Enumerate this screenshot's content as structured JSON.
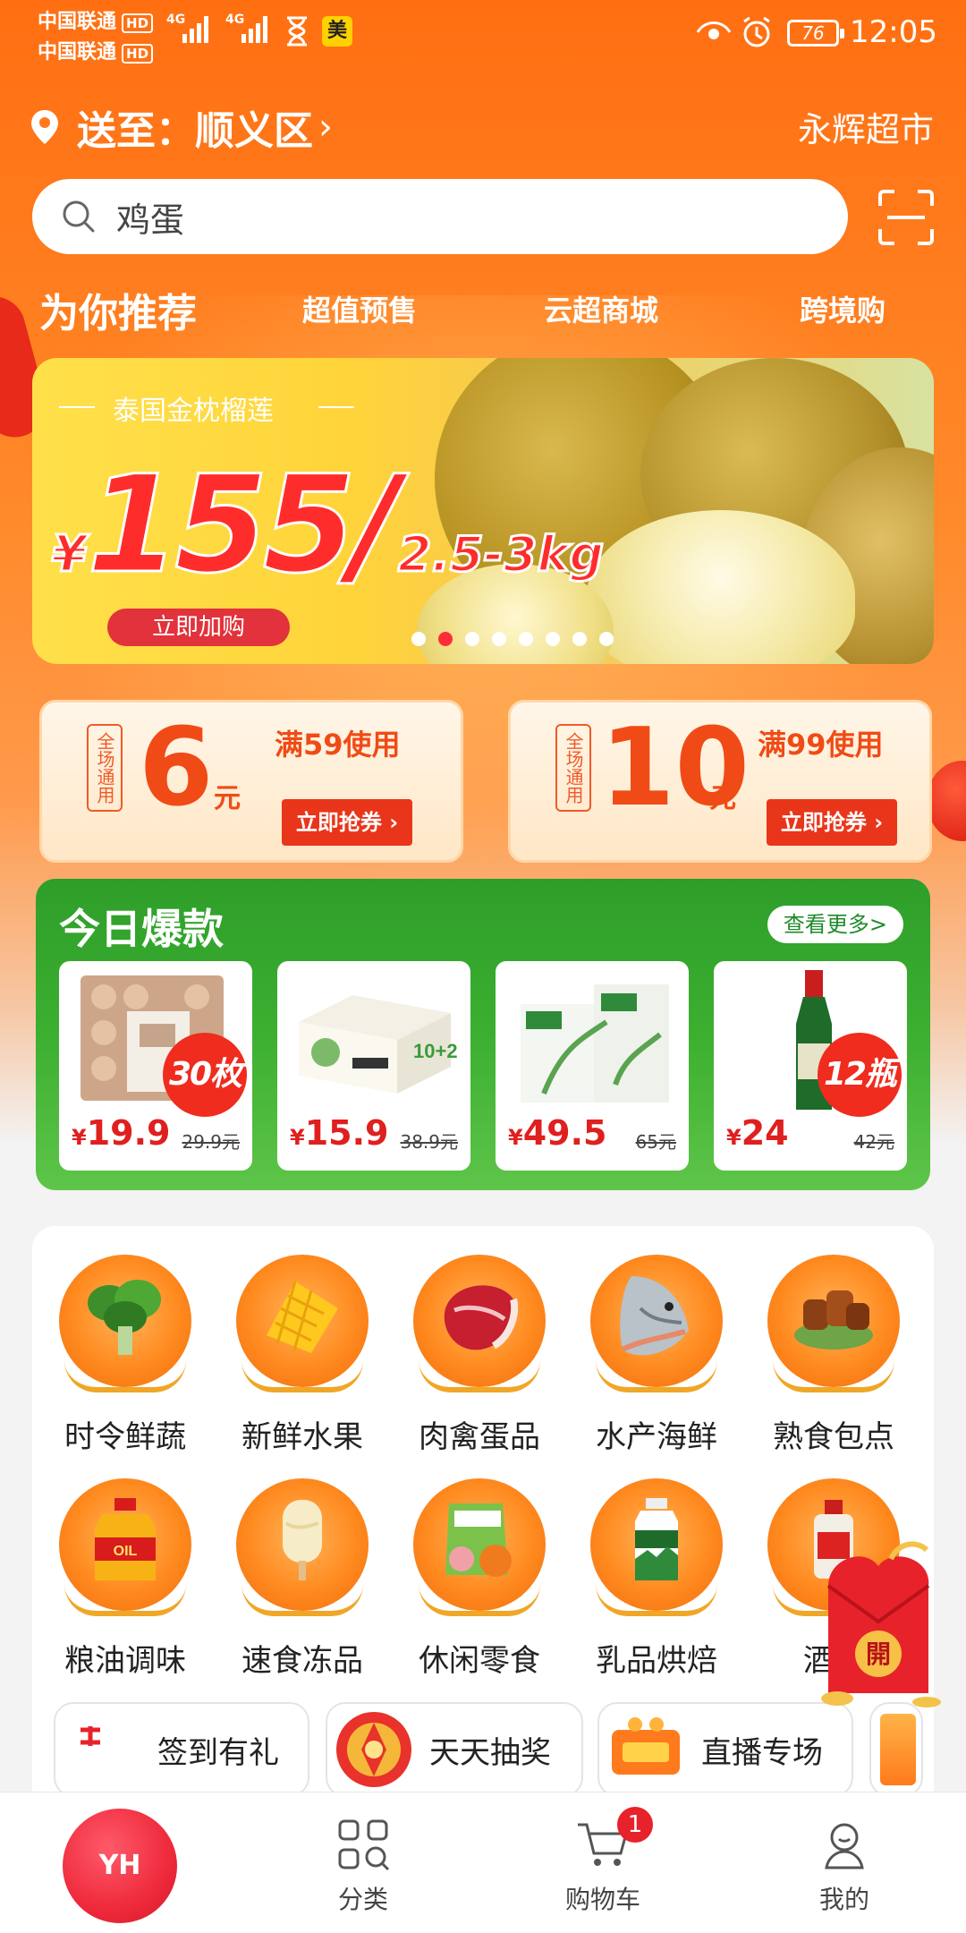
{
  "status": {
    "carrier1": "中国联通",
    "carrier2": "中国联通",
    "hd": "HD",
    "net": "4G",
    "app_badge": "美",
    "battery": "76",
    "time": "12:05"
  },
  "header": {
    "deliver_label": "送至：顺义区",
    "chevron": "›",
    "store_name": "永辉超市"
  },
  "search": {
    "value": "鸡蛋"
  },
  "tabs": [
    "为你推荐",
    "超值预售",
    "云超商城",
    "跨境购"
  ],
  "banner": {
    "subtitle": "泰国金枕榴莲",
    "currency": "¥",
    "price": "155/",
    "unit": "2.5-3kg",
    "cta": "立即加购",
    "slide_count": 8,
    "active_slide": 2
  },
  "coupons": [
    {
      "tag": "全场通用",
      "amount": "6",
      "yuan": "元",
      "condition": "满59使用",
      "button": "立即抢券 ›"
    },
    {
      "tag": "全场通用",
      "amount": "10",
      "yuan": "元",
      "condition": "满99使用",
      "button": "立即抢券 ›"
    }
  ],
  "hot": {
    "title": "今日爆款",
    "more": "查看更多>",
    "products": [
      {
        "badge": "30枚",
        "currency": "¥",
        "price": "19.9",
        "original": "29.9元"
      },
      {
        "badge": "",
        "currency": "¥",
        "price": "15.9",
        "original": "38.9元"
      },
      {
        "badge": "",
        "currency": "¥",
        "price": "49.5",
        "original": "65元"
      },
      {
        "badge": "12瓶",
        "currency": "¥",
        "price": "24",
        "original": "42元"
      }
    ]
  },
  "categories": [
    {
      "label": "时令鲜蔬",
      "icon": "vegetable-icon"
    },
    {
      "label": "新鲜水果",
      "icon": "mango-icon"
    },
    {
      "label": "肉禽蛋品",
      "icon": "meat-icon"
    },
    {
      "label": "水产海鲜",
      "icon": "fish-icon"
    },
    {
      "label": "熟食包点",
      "icon": "cooked-food-icon"
    },
    {
      "label": "粮油调味",
      "icon": "oil-icon"
    },
    {
      "label": "速食冻品",
      "icon": "ice-cream-icon"
    },
    {
      "label": "休闲零食",
      "icon": "snack-icon"
    },
    {
      "label": "乳品烘焙",
      "icon": "milk-icon"
    },
    {
      "label": "酒饮",
      "icon": "liquor-icon"
    }
  ],
  "chips": [
    {
      "label": "签到有礼",
      "icon": "sign-in-icon"
    },
    {
      "label": "天天抽奖",
      "icon": "lottery-icon"
    },
    {
      "label": "直播专场",
      "icon": "live-icon"
    }
  ],
  "red_packet": {
    "label": "開"
  },
  "nav": {
    "home": "YH",
    "items": [
      {
        "label": "分类"
      },
      {
        "label": "购物车",
        "count": "1"
      },
      {
        "label": "我的"
      }
    ]
  },
  "colors": {
    "brand_orange": "#ff7a1c",
    "price_red": "#e01f1f",
    "hot_green": "#3caf30"
  }
}
